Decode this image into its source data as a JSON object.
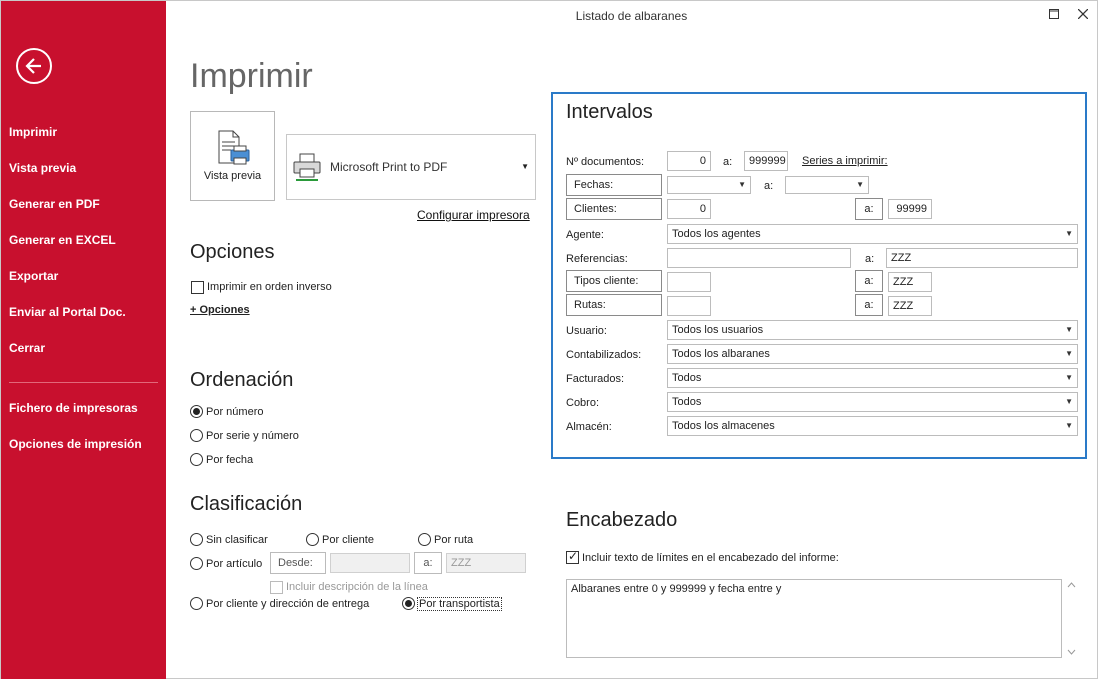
{
  "window": {
    "title": "Listado de albaranes",
    "maximize_icon": "maximize-icon",
    "close_icon": "close-icon"
  },
  "sidebar": {
    "back_icon": "back-arrow-icon",
    "items": [
      {
        "label": "Imprimir"
      },
      {
        "label": "Vista previa"
      },
      {
        "label": "Generar en PDF"
      },
      {
        "label": "Generar en EXCEL"
      },
      {
        "label": "Exportar"
      },
      {
        "label": "Enviar al Portal Doc."
      },
      {
        "label": "Cerrar"
      }
    ],
    "bottom_items": [
      {
        "label": "Fichero de impresoras"
      },
      {
        "label": "Opciones de impresión"
      }
    ],
    "bg_color": "#c8102e"
  },
  "main": {
    "title": "Imprimir",
    "preview_button": "Vista previa",
    "printer": "Microsoft Print to PDF",
    "configure_printer": "Configurar impresora"
  },
  "opciones": {
    "title": "Opciones",
    "reverse_order": "Imprimir en orden inverso",
    "more_options": "+ Opciones"
  },
  "ordenacion": {
    "title": "Ordenación",
    "options": [
      "Por número",
      "Por serie y número",
      "Por fecha"
    ],
    "selected": 0
  },
  "clasificacion": {
    "title": "Clasificación",
    "sin_clasificar": "Sin clasificar",
    "por_cliente": "Por cliente",
    "por_ruta": "Por ruta",
    "por_articulo": "Por artículo",
    "desde_label": "Desde:",
    "desde_value": "",
    "a_label": "a:",
    "a_value": "ZZZ",
    "incluir_descripcion": "Incluir descripción de la línea",
    "por_cliente_direccion": "Por cliente y dirección de entrega",
    "por_transportista": "Por transportista",
    "selected": "por_transportista"
  },
  "intervalos": {
    "title": "Intervalos",
    "border_color": "#2a7ac8",
    "num_docs_label": "Nº documentos:",
    "num_docs_from": "0",
    "a_label": "a:",
    "num_docs_to": "999999",
    "series_link": "Series a imprimir:",
    "fechas_btn": "Fechas:",
    "fechas_from": "",
    "fechas_to": "",
    "clientes_btn": "Clientes:",
    "clientes_from": "0",
    "clientes_to": "99999",
    "agente_label": "Agente:",
    "agente_value": "Todos los agentes",
    "referencias_label": "Referencias:",
    "referencias_from": "",
    "referencias_to": "ZZZ",
    "tipos_cliente_btn": "Tipos cliente:",
    "tipos_from": "",
    "tipos_to": "ZZZ",
    "rutas_btn": "Rutas:",
    "rutas_from": "",
    "rutas_to": "ZZZ",
    "usuario_label": "Usuario:",
    "usuario_value": "Todos los usuarios",
    "contabilizados_label": "Contabilizados:",
    "contabilizados_value": "Todos los albaranes",
    "facturados_label": "Facturados:",
    "facturados_value": "Todos",
    "cobro_label": "Cobro:",
    "cobro_value": "Todos",
    "almacen_label": "Almacén:",
    "almacen_value": "Todos los almacenes"
  },
  "encabezado": {
    "title": "Encabezado",
    "include_limits": "Incluir texto de límites en el encabezado del informe:",
    "include_checked": true,
    "text": "Albaranes entre 0 y 999999 y fecha entre  y"
  }
}
